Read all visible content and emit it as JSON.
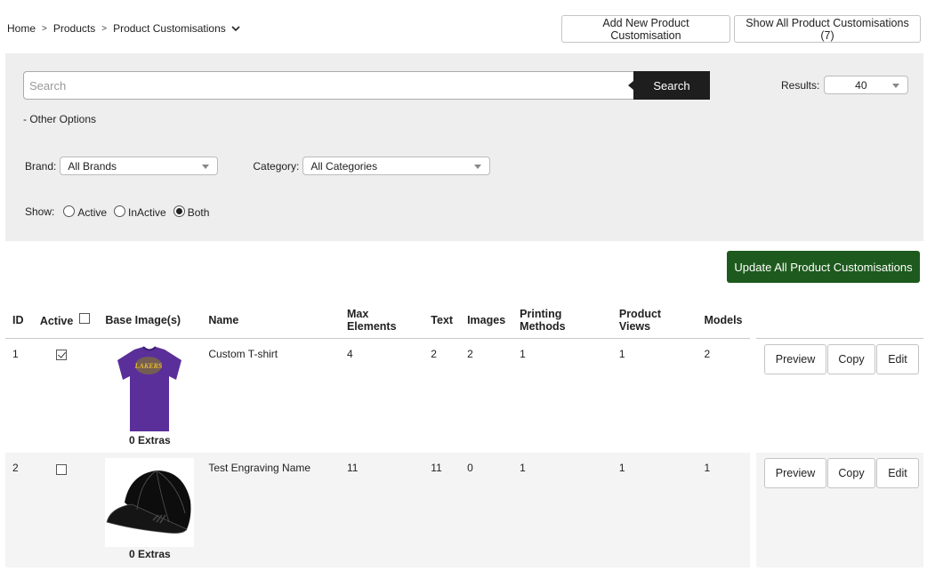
{
  "breadcrumb": {
    "items": [
      "Home",
      "Products",
      "Product Customisations"
    ],
    "separator": ">"
  },
  "top_buttons": {
    "add_new": "Add New Product Customisation",
    "show_all": "Show All Product Customisations (7)"
  },
  "filters": {
    "search_placeholder": "Search",
    "search_value": "",
    "search_button": "Search",
    "results_label": "Results:",
    "results_value": "40",
    "other_options": "- Other Options",
    "brand_label": "Brand:",
    "brand_value": "All Brands",
    "category_label": "Category:",
    "category_value": "All Categories",
    "show_label": "Show:",
    "show_options": [
      {
        "label": "Active",
        "selected": false
      },
      {
        "label": "InActive",
        "selected": false
      },
      {
        "label": "Both",
        "selected": true
      }
    ]
  },
  "update_all_button": "Update All Product Customisations",
  "colors": {
    "panel_bg": "#eeeeee",
    "update_button": "#1e5a1e",
    "search_button": "#1e1e1e"
  },
  "table": {
    "columns": [
      "ID",
      "Active",
      "Base Image(s)",
      "Name",
      "Max Elements",
      "Text",
      "Images",
      "Printing Methods",
      "Product Views",
      "Models"
    ],
    "rows": [
      {
        "id": "1",
        "active": true,
        "image": "purple-lakers-tshirt",
        "extras": "0 Extras",
        "name": "Custom T-shirt",
        "max_elements": "4",
        "text": "2",
        "images": "2",
        "printing_methods": "1",
        "product_views": "1",
        "models": "2",
        "actions": [
          "Preview",
          "Copy",
          "Edit"
        ]
      },
      {
        "id": "2",
        "active": false,
        "image": "black-adidas-cap",
        "extras": "0 Extras",
        "name": "Test Engraving Name",
        "max_elements": "11",
        "text": "11",
        "images": "0",
        "printing_methods": "1",
        "product_views": "1",
        "models": "1",
        "actions": [
          "Preview",
          "Copy",
          "Edit"
        ]
      }
    ]
  }
}
